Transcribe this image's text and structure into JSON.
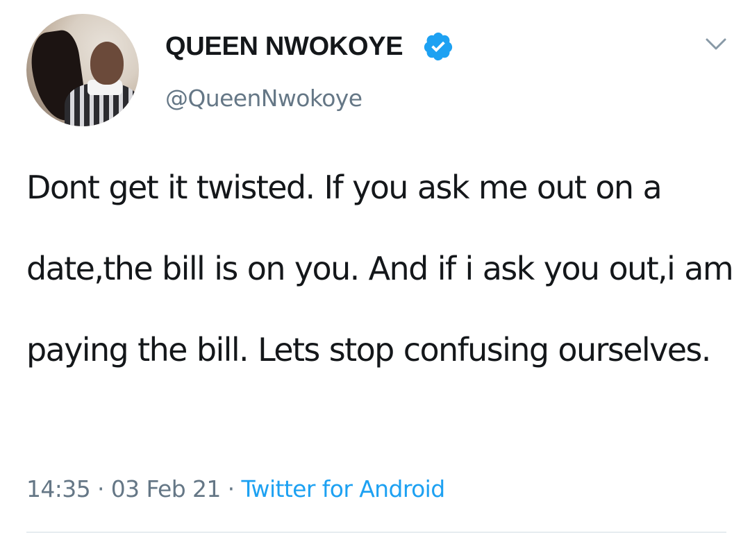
{
  "tweet": {
    "author": {
      "display_name": "QUEEN NWOKOYE",
      "handle": "@QueenNwokoye",
      "verified": true,
      "avatar_icon": "profile-photo"
    },
    "text": "Dont get it twisted. If you ask me out on a date,the bill is on you. And if i ask you out,i am paying the bill. Lets stop confusing ourselves.",
    "time": "14:35",
    "separator": "·",
    "date": "03 Feb 21",
    "source": "Twitter for Android",
    "menu_icon": "chevron-down-icon"
  },
  "colors": {
    "text": "#14171a",
    "secondary": "#657786",
    "accent": "#1da1f2",
    "divider": "#e6ecf0"
  }
}
